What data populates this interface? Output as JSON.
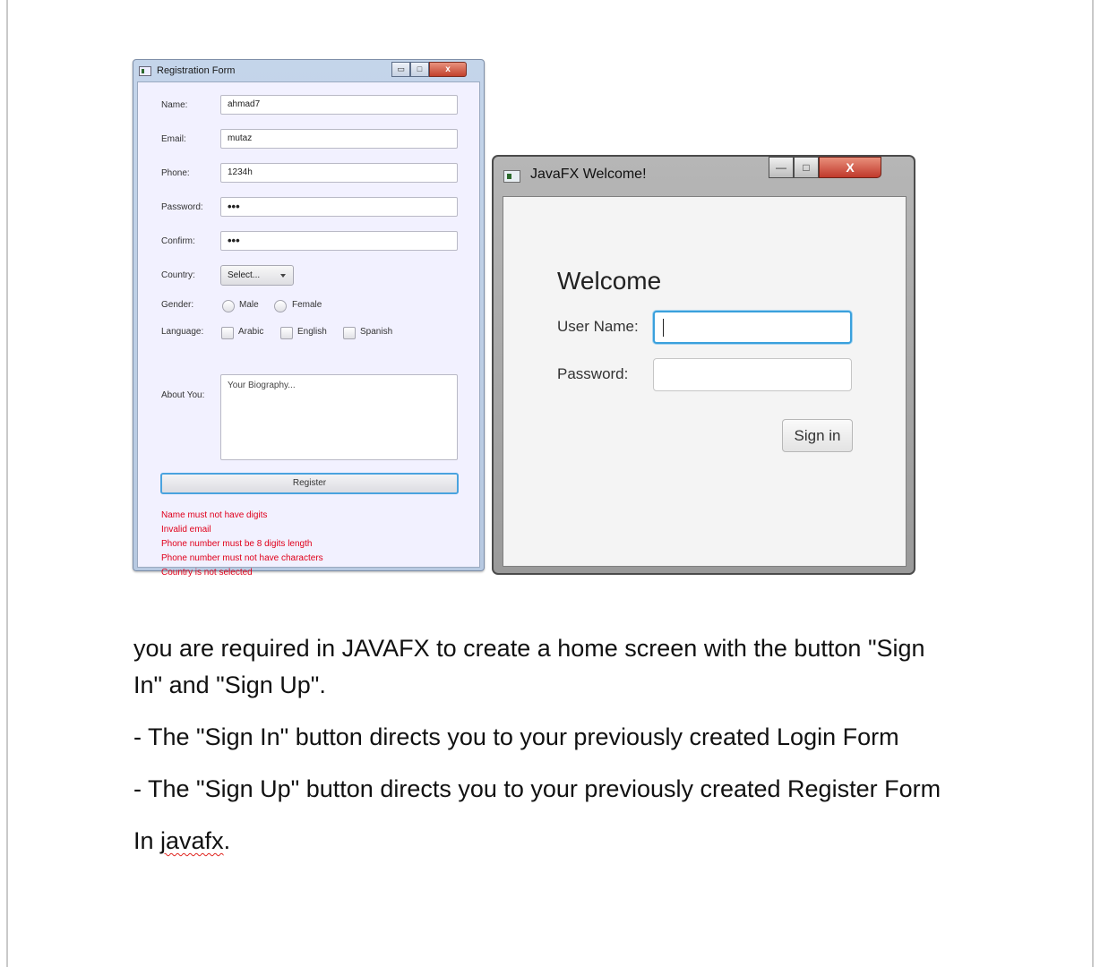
{
  "registration_form": {
    "title": "Registration Form",
    "controls": {
      "minimize": "▭",
      "maximize": "□",
      "close": "x"
    },
    "labels": {
      "name": "Name:",
      "email": "Email:",
      "phone": "Phone:",
      "password": "Password:",
      "confirm": "Confirm:",
      "country": "Country:",
      "gender": "Gender:",
      "language": "Language:",
      "about": "About You:"
    },
    "values": {
      "name": "ahmad7",
      "email": "mutaz",
      "phone": "1234h",
      "password": "•••",
      "confirm": "•••"
    },
    "country_select": "Select...",
    "gender_options": [
      "Male",
      "Female"
    ],
    "language_options": [
      "Arabic",
      "English",
      "Spanish"
    ],
    "about_placeholder": "Your Biography...",
    "register_button": "Register",
    "errors": [
      "Name must not have digits",
      "Invalid email",
      "Phone number must be 8 digits length",
      "Phone number must not have characters",
      "Country is not selected"
    ]
  },
  "welcome_window": {
    "title": "JavaFX Welcome!",
    "controls": {
      "minimize": "—",
      "maximize": "□",
      "close": "X"
    },
    "heading": "Welcome",
    "username_label": "User Name:",
    "password_label": "Password:",
    "signin_button": "Sign in"
  },
  "document": {
    "paragraphs": [
      "you are required in JAVAFX to create a home screen with the button \"Sign In\" and \"Sign Up\".",
      "- The \"Sign In\" button directs you to your previously created Login Form",
      "- The \"Sign Up\" button directs you to your previously created Register Form"
    ],
    "last_line_prefix": "In ",
    "last_line_word": "javafx",
    "last_line_suffix": "."
  }
}
